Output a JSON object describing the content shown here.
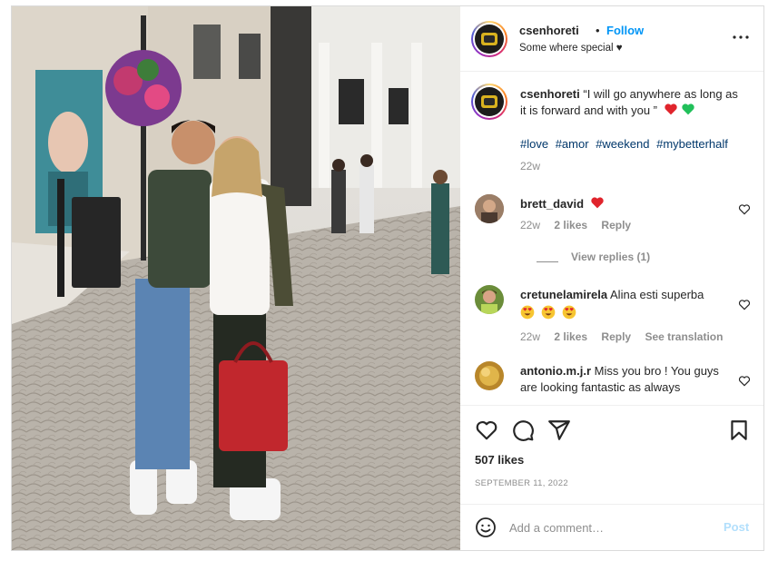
{
  "post": {
    "username": "csenhoreti",
    "separator": "•",
    "follow_label": "Follow",
    "location": "Some where special ♥",
    "caption_text": "“I will go anywhere as long as it is forward and with you ”",
    "caption_emojis": [
      "red-heart",
      "green-heart"
    ],
    "hashtags": [
      "#love",
      "#amor",
      "#weekend",
      "#mybetterhalf"
    ],
    "caption_age": "22w"
  },
  "comments": [
    {
      "username": "brett_david",
      "text": "",
      "emojis": [
        "red-heart"
      ],
      "age": "22w",
      "likes": "2 likes",
      "reply_label": "Reply",
      "view_replies": "View replies (1)"
    },
    {
      "username": "cretunelamirela",
      "text": "Alina esti superba",
      "emojis": [
        "heart-eyes",
        "heart-eyes",
        "heart-eyes"
      ],
      "age": "22w",
      "likes": "2 likes",
      "reply_label": "Reply",
      "translation_label": "See translation"
    },
    {
      "username": "antonio.m.j.r",
      "text": "Miss you bro ! You guys are looking fantastic as always",
      "age": "",
      "likes": "",
      "reply_label": ""
    }
  ],
  "actions": {
    "likes": "507 likes",
    "date": "SEPTEMBER 11, 2022"
  },
  "add_comment": {
    "placeholder": "Add a comment…",
    "post_label": "Post"
  },
  "colors": {
    "follow": "#0095f6",
    "hashtag": "#00376b",
    "post_disabled": "#b2dffc",
    "muted": "#8e8e8e",
    "heart_red": "#ed4956"
  }
}
